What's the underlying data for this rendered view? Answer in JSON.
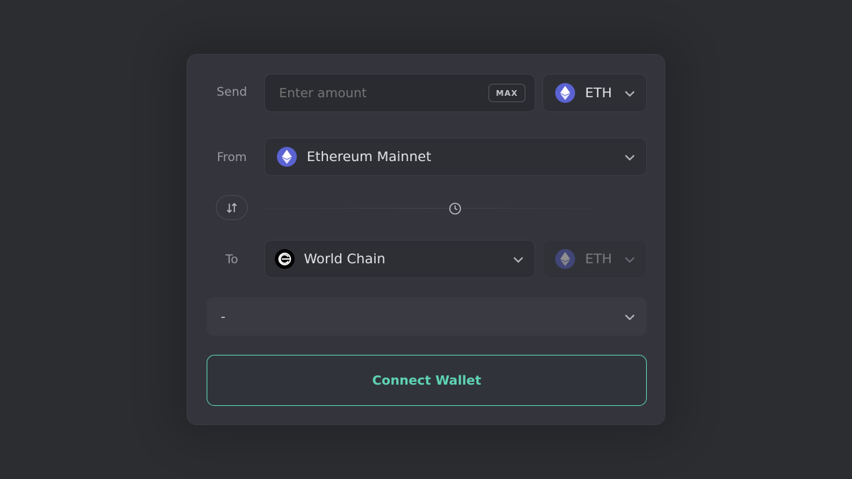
{
  "send": {
    "label": "Send",
    "amount_placeholder": "Enter amount",
    "max_label": "MAX",
    "token": "ETH"
  },
  "from": {
    "label": "From",
    "network": "Ethereum Mainnet"
  },
  "to": {
    "label": "To",
    "network": "World Chain",
    "token": "ETH"
  },
  "route": {
    "value": "-"
  },
  "connect_button": {
    "label": "Connect Wallet"
  },
  "colors": {
    "background": "#2c2d31",
    "card": "#34353c",
    "field": "#2a2b30",
    "accent": "#5fd3b3",
    "eth_badge": "#5b63d3"
  },
  "icons": {
    "token": "ethereum-icon",
    "from_network": "ethereum-icon",
    "to_network": "world-chain-icon",
    "swap": "swap-arrows-icon",
    "timer": "clock-icon",
    "dropdown": "chevron-down-icon"
  }
}
